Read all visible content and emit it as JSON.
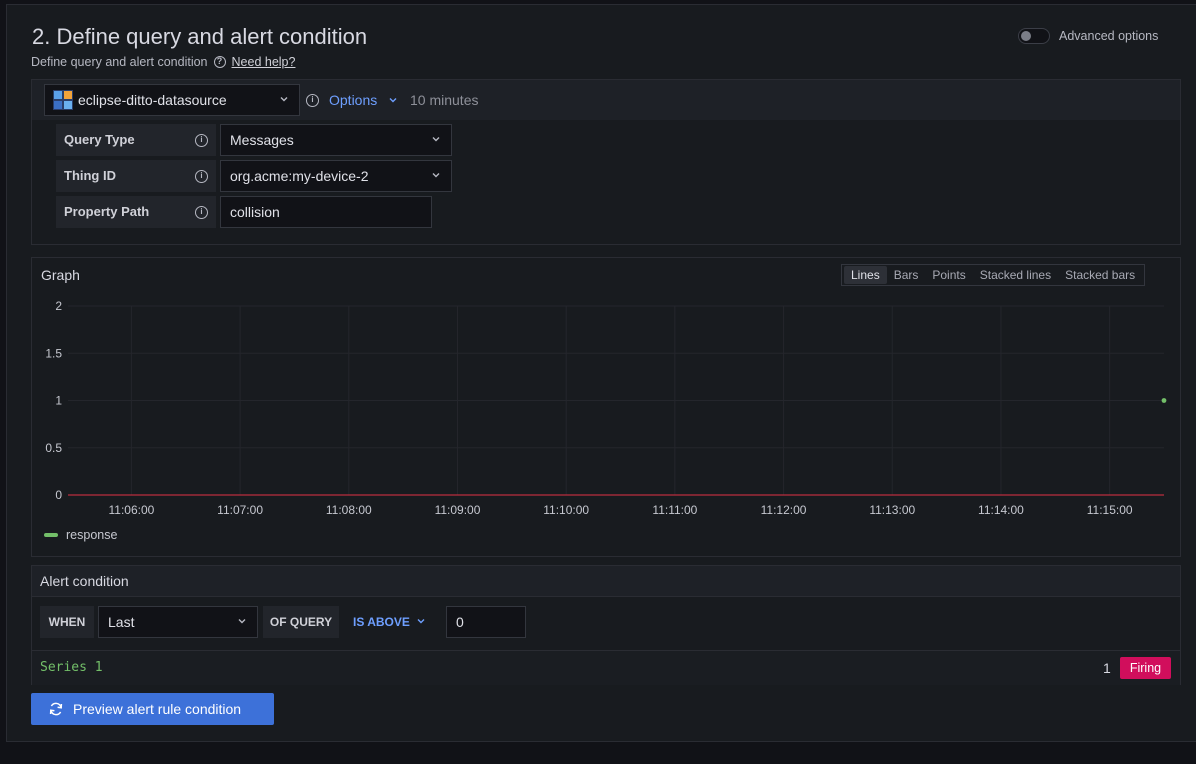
{
  "section": {
    "title": "2. Define query and alert condition",
    "subtitle": "Define query and alert condition",
    "help_link": "Need help?",
    "advanced_options_label": "Advanced options",
    "advanced_options_on": false
  },
  "query": {
    "datasource": "eclipse-ditto-datasource",
    "options_label": "Options",
    "interval": "10 minutes",
    "fields": [
      {
        "label": "Query Type",
        "value": "Messages",
        "kind": "select"
      },
      {
        "label": "Thing ID",
        "value": "org.acme:my-device-2",
        "kind": "select"
      },
      {
        "label": "Property Path",
        "value": "collision",
        "kind": "input"
      }
    ]
  },
  "graph": {
    "title": "Graph",
    "tabs": [
      "Lines",
      "Bars",
      "Points",
      "Stacked lines",
      "Stacked bars"
    ],
    "active_tab": "Lines"
  },
  "chart_data": {
    "type": "line",
    "x": [
      "11:06:00",
      "11:07:00",
      "11:08:00",
      "11:09:00",
      "11:10:00",
      "11:11:00",
      "11:12:00",
      "11:13:00",
      "11:14:00",
      "11:15:00"
    ],
    "xlim": [
      "11:05:25",
      "11:15:30"
    ],
    "yticks": [
      "0",
      "0.5",
      "1",
      "1.5",
      "2"
    ],
    "ylim": [
      0,
      2
    ],
    "series": [
      {
        "name": "response",
        "color": "#73bf69",
        "points": [
          {
            "x": "11:15:30",
            "y": 1
          }
        ]
      }
    ],
    "threshold": {
      "value": 0,
      "color": "#e02f44"
    },
    "grid": true,
    "legend": "bottom-left"
  },
  "alert": {
    "title": "Alert condition",
    "when_label": "WHEN",
    "reducer": "Last",
    "of_query_label": "OF QUERY",
    "evaluator": "IS ABOVE",
    "threshold": "0",
    "result_series": "Series 1",
    "result_value": "1",
    "result_state": "Firing"
  },
  "actions": {
    "preview_label": "Preview alert rule condition"
  }
}
